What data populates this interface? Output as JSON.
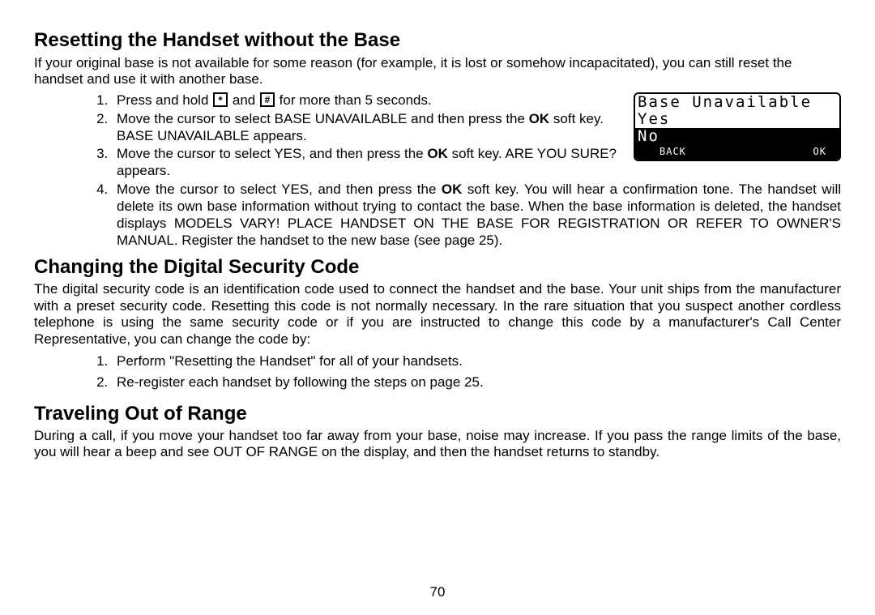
{
  "section1": {
    "title": "Resetting the Handset without the Base",
    "intro": "If your original base is not available for some reason (for example, it is lost or somehow incapacitated), you can still reset the handset and use it with another base.",
    "steps": {
      "s1_a": "Press and hold ",
      "s1_b": " and ",
      "s1_c": " for more than 5 seconds.",
      "key1_label": "[*]",
      "key2_label": "[#]",
      "s2_a": "Move the cursor to select BASE UNAVAILABLE and then press the ",
      "s2_ok": "OK",
      "s2_b": " soft key. BASE UNAVAILABLE appears.",
      "s3_a": "Move the cursor to select YES, and then press the ",
      "s3_ok": "OK",
      "s3_b": " soft key. ARE YOU SURE? appears.",
      "s4_a": "Move the cursor to select YES, and then press the ",
      "s4_ok": "OK",
      "s4_b": " soft key. You will hear a confirmation tone. The handset will delete its own base information without trying to contact the base. When the base information is deleted, the handset displays MODELS VARY! PLACE HANDSET ON THE BASE FOR REGISTRATION OR REFER TO OWNER'S MANUAL. Register the handset to the new base (see page 25)."
    },
    "lcd": {
      "line1": "Base Unavailable",
      "line2": "Yes",
      "line3": "No",
      "back": "BACK",
      "ok": "OK"
    }
  },
  "section2": {
    "title": "Changing the Digital Security Code",
    "intro": "The digital security code is an identification code used to connect the handset and the base. Your unit ships from the manufacturer with a preset security code. Resetting this code is not normally necessary. In the rare situation that you suspect another cordless telephone is using the same security code or if you are instructed to change this code by a manufacturer's Call Center Representative, you can change the code by:",
    "steps": {
      "s1": "Perform \"Resetting the Handset\" for all of your handsets.",
      "s2": "Re-register each handset by following the steps on page 25."
    }
  },
  "section3": {
    "title": "Traveling Out of Range",
    "body": "During a call, if you move your handset too far away from your base, noise may increase. If you pass the range limits of the base, you will hear a beep and see OUT OF RANGE on the display, and then the handset returns to standby."
  },
  "page_number": "70"
}
